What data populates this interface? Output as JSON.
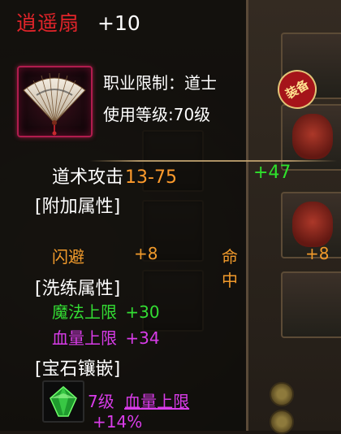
{
  "item": {
    "name": "逍遥扇",
    "enhance": "+10",
    "class_limit": "职业限制：道士",
    "level_req": "使用等级:70级"
  },
  "base_attack": {
    "label": "道术攻击",
    "range": "13-75",
    "bonus": "+47"
  },
  "sections": {
    "additional": "[附加属性]",
    "refine": "[洗练属性]",
    "gem": "[宝石镶嵌]"
  },
  "additional_stats": [
    {
      "label": "闪避",
      "value": "+8"
    },
    {
      "label": "命中",
      "value": "+8"
    }
  ],
  "refine_stats": [
    {
      "label": "魔法上限",
      "value": "+30"
    },
    {
      "label": "血量上限",
      "value": "+34"
    }
  ],
  "gem": {
    "level": "7级",
    "label": "血量上限",
    "value": "+14%"
  },
  "badge": {
    "text": "装备"
  },
  "colors": {
    "name": "#e0242a",
    "attack_range": "#ff9b2c",
    "attack_bonus": "#2ee12c",
    "stat_orange": "#f19a2b",
    "stat_green": "#33dd33",
    "stat_purple": "#d93ce9"
  }
}
